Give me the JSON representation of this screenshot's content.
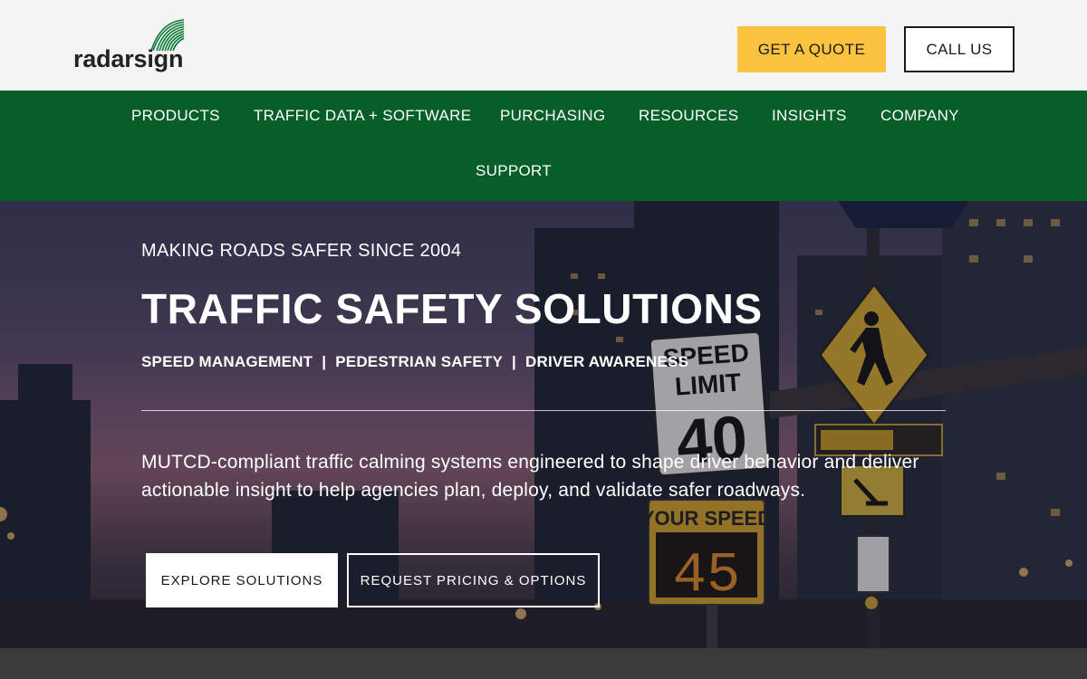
{
  "header": {
    "logo_text": "radarsign",
    "quote_button": "GET A QUOTE",
    "call_button": "CALL US"
  },
  "nav": {
    "items": [
      "PRODUCTS",
      "TRAFFIC DATA + SOFTWARE",
      "PURCHASING",
      "RESOURCES",
      "INSIGHTS",
      "COMPANY",
      "SUPPORT"
    ]
  },
  "hero": {
    "eyebrow": "MAKING ROADS SAFER SINCE 2004",
    "title": "TRAFFIC SAFETY SOLUTIONS",
    "pillars": [
      "SPEED MANAGEMENT",
      "PEDESTRIAN SAFETY",
      "DRIVER AWARENESS"
    ],
    "pillar_separator": "|",
    "description": "MUTCD-compliant traffic calming systems engineered to shape driver behavior and deliver actionable insight to help agencies plan, deploy, and validate safer roadways.",
    "primary_button": "EXPLORE SOLUTIONS",
    "secondary_button": "REQUEST PRICING & OPTIONS"
  },
  "background_signs": {
    "speed_limit_top": "SPEED",
    "speed_limit_mid": "LIMIT",
    "speed_limit_value": "40",
    "your_speed_label": "YOUR SPEED",
    "your_speed_value": "45"
  },
  "colors": {
    "brand_green": "#075e28",
    "accent_yellow": "#fcc340",
    "header_bg": "#f4f4f4",
    "footer_strip": "#3b3b3b"
  }
}
